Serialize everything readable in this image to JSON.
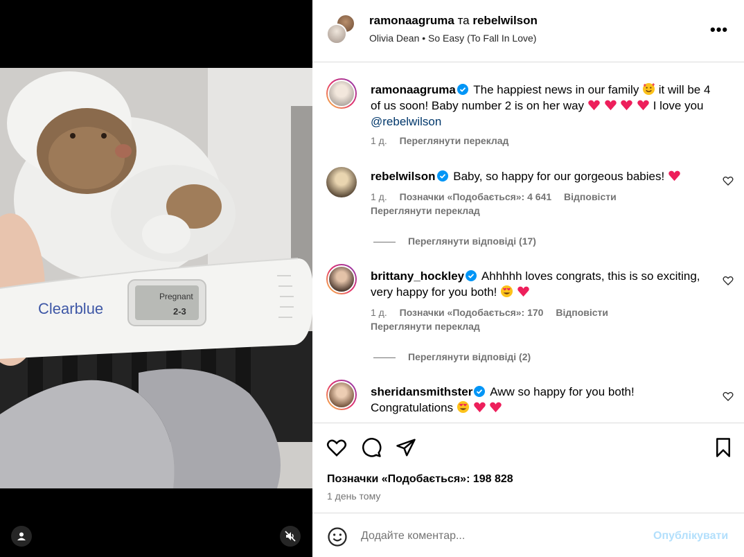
{
  "header": {
    "user1": "ramonaagruma",
    "conjunction": "та",
    "user2": "rebelwilson",
    "audio": "Olivia Dean • So Easy (To Fall In Love)",
    "more_icon": "more-horizontal-icon"
  },
  "media": {
    "test_brand": "Clearblue",
    "test_result": "Pregnant",
    "test_weeks": "2-3",
    "user_icon": "user-tag-icon",
    "mute_icon": "audio-muted-icon"
  },
  "comments": [
    {
      "user": "ramonaagruma",
      "text1": "The happiest news in our family",
      "text2": "it will be 4 of us soon! Baby number 2 is on her way",
      "text3": "I love you",
      "mention": "@rebelwilson",
      "time": "1 д.",
      "translate": "Переглянути переклад"
    },
    {
      "user": "rebelwilson",
      "text": "Baby, so happy for our gorgeous babies!",
      "time": "1 д.",
      "likes": "Позначки «Подобається»: 4 641",
      "reply": "Відповісти",
      "translate": "Переглянути переклад",
      "view_replies": "Переглянути відповіді (17)"
    },
    {
      "user": "brittany_hockley",
      "text": "Ahhhhh loves congrats, this is so exciting, very happy for you both!",
      "time": "1 д.",
      "likes": "Позначки «Подобається»: 170",
      "reply": "Відповісти",
      "translate": "Переглянути переклад",
      "view_replies": "Переглянути відповіді (2)"
    },
    {
      "user": "sheridansmithster",
      "text1": "Aww so happy for you both!",
      "text2": "Congratulations"
    }
  ],
  "actions": {
    "likes": "Позначки «Подобається»: 198 828",
    "time": "1 день тому"
  },
  "add_comment": {
    "placeholder": "Додайте коментар...",
    "publish": "Опублікувати"
  }
}
